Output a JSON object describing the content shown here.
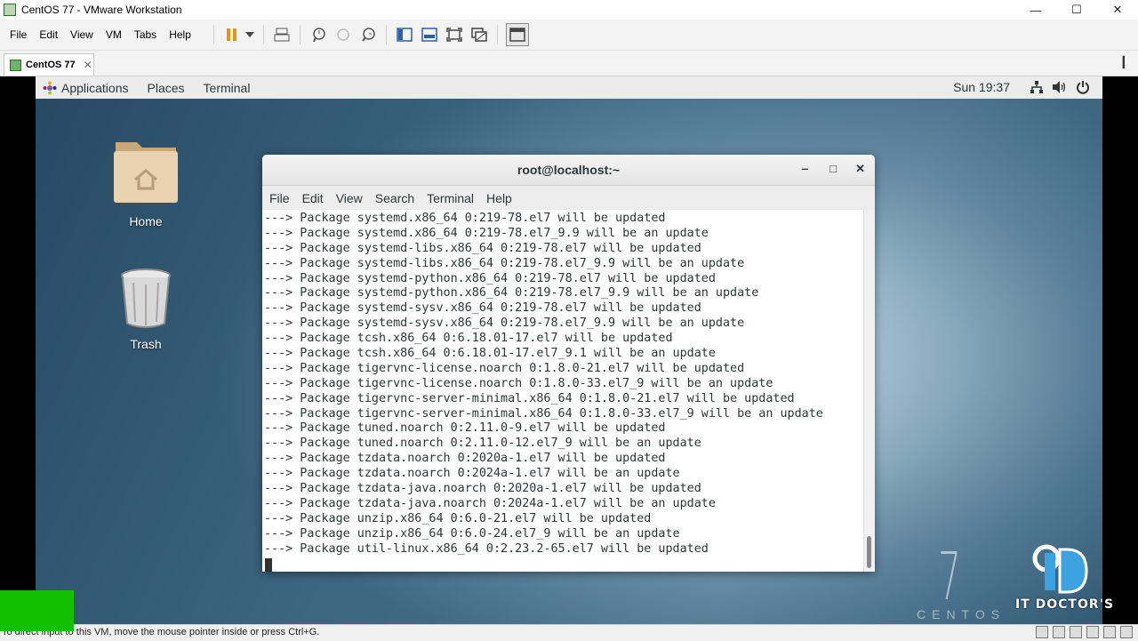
{
  "window": {
    "title": "CentOS 77 - VMware Workstation",
    "minimize": "—",
    "maximize": "☐",
    "close": "✕"
  },
  "menu": [
    "File",
    "Edit",
    "View",
    "VM",
    "Tabs",
    "Help"
  ],
  "toolbar_icons": [
    "pause-icon",
    "dropdown-arrow-icon",
    "send-keys-icon",
    "snapshot-take-icon",
    "snapshot-revert-icon",
    "snapshot-manager-icon",
    "console-view-icon",
    "fit-guest-icon",
    "full-screen-icon",
    "unity-icon",
    "thumbnail-icon"
  ],
  "tab": {
    "label": "CentOS 77",
    "close": "✕"
  },
  "gnome_bar": {
    "applications": "Applications",
    "places": "Places",
    "terminal": "Terminal",
    "clock": "Sun 19:37"
  },
  "desktop": {
    "home_label": "Home",
    "trash_label": "Trash",
    "centos_number": "7",
    "centos_word": "CENTOS"
  },
  "terminal": {
    "title": "root@localhost:~",
    "minimize": "‒",
    "maximize": "□",
    "close": "✕",
    "menu": [
      "File",
      "Edit",
      "View",
      "Search",
      "Terminal",
      "Help"
    ],
    "lines": [
      "---> Package systemd.x86_64 0:219-78.el7 will be updated",
      "---> Package systemd.x86_64 0:219-78.el7_9.9 will be an update",
      "---> Package systemd-libs.x86_64 0:219-78.el7 will be updated",
      "---> Package systemd-libs.x86_64 0:219-78.el7_9.9 will be an update",
      "---> Package systemd-python.x86_64 0:219-78.el7 will be updated",
      "---> Package systemd-python.x86_64 0:219-78.el7_9.9 will be an update",
      "---> Package systemd-sysv.x86_64 0:219-78.el7 will be updated",
      "---> Package systemd-sysv.x86_64 0:219-78.el7_9.9 will be an update",
      "---> Package tcsh.x86_64 0:6.18.01-17.el7 will be updated",
      "---> Package tcsh.x86_64 0:6.18.01-17.el7_9.1 will be an update",
      "---> Package tigervnc-license.noarch 0:1.8.0-21.el7 will be updated",
      "---> Package tigervnc-license.noarch 0:1.8.0-33.el7_9 will be an update",
      "---> Package tigervnc-server-minimal.x86_64 0:1.8.0-21.el7 will be updated",
      "---> Package tigervnc-server-minimal.x86_64 0:1.8.0-33.el7_9 will be an update",
      "---> Package tuned.noarch 0:2.11.0-9.el7 will be updated",
      "---> Package tuned.noarch 0:2.11.0-12.el7_9 will be an update",
      "---> Package tzdata.noarch 0:2020a-1.el7 will be updated",
      "---> Package tzdata.noarch 0:2024a-1.el7 will be an update",
      "---> Package tzdata-java.noarch 0:2020a-1.el7 will be updated",
      "---> Package tzdata-java.noarch 0:2024a-1.el7 will be an update",
      "---> Package unzip.x86_64 0:6.0-21.el7 will be updated",
      "---> Package unzip.x86_64 0:6.0-24.el7_9 will be an update",
      "---> Package util-linux.x86_64 0:2.23.2-65.el7 will be updated"
    ]
  },
  "status_bar": {
    "message": "To direct input to this VM, move the mouse pointer inside or press Ctrl+G."
  },
  "watermark": {
    "text": "IT DOCTOR'S"
  }
}
